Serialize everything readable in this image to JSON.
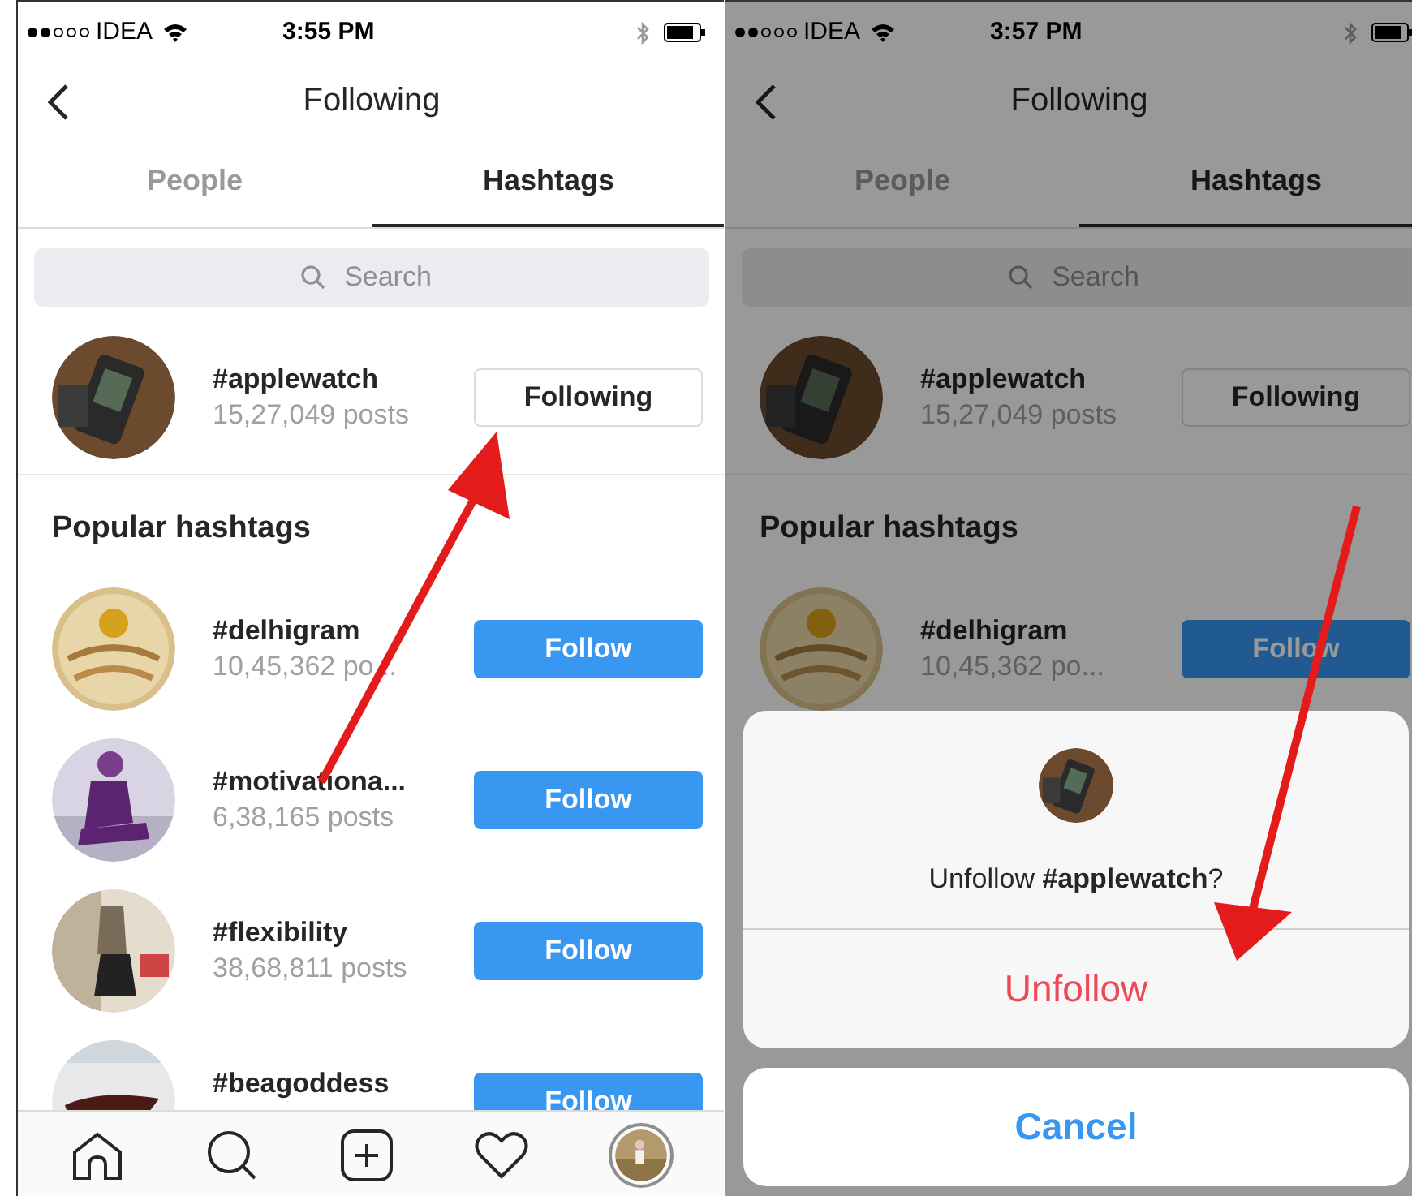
{
  "screens": [
    {
      "status_bar": {
        "carrier": "IDEA",
        "time": "3:55 PM"
      },
      "title": "Following",
      "tabs": [
        {
          "label": "People",
          "selected": false
        },
        {
          "label": "Hashtags",
          "selected": true
        }
      ],
      "search": {
        "placeholder": "Search"
      },
      "following": {
        "tag": "#applewatch",
        "posts": "15,27,049 posts",
        "button": "Following",
        "following": true
      },
      "section_title": "Popular hashtags",
      "hashtags": [
        {
          "tag": "#delhigram",
          "posts": "10,45,362 po...",
          "button": "Follow",
          "following": false
        },
        {
          "tag": "#motivationa...",
          "posts": "6,38,165 posts",
          "button": "Follow",
          "following": false
        },
        {
          "tag": "#flexibility",
          "posts": "38,68,811 posts",
          "button": "Follow",
          "following": false
        },
        {
          "tag": "#beagoddess",
          "button": "Follow",
          "following": false
        }
      ]
    },
    {
      "status_bar": {
        "carrier": "IDEA",
        "time": "3:57 PM"
      },
      "title": "Following",
      "tabs": [
        {
          "label": "People",
          "selected": false
        },
        {
          "label": "Hashtags",
          "selected": true
        }
      ],
      "search": {
        "placeholder": "Search"
      },
      "following": {
        "tag": "#applewatch",
        "posts": "15,27,049 posts",
        "button": "Following",
        "following": true
      },
      "section_title": "Popular hashtags",
      "hashtags": [
        {
          "tag": "#delhigram",
          "posts": "10,45,362 po...",
          "button": "Follow",
          "following": false
        }
      ],
      "dimmed": true,
      "sheet": {
        "message": "Unfollow **#applewatch**?",
        "action": "Unfollow",
        "cancel": "Cancel"
      }
    }
  ]
}
